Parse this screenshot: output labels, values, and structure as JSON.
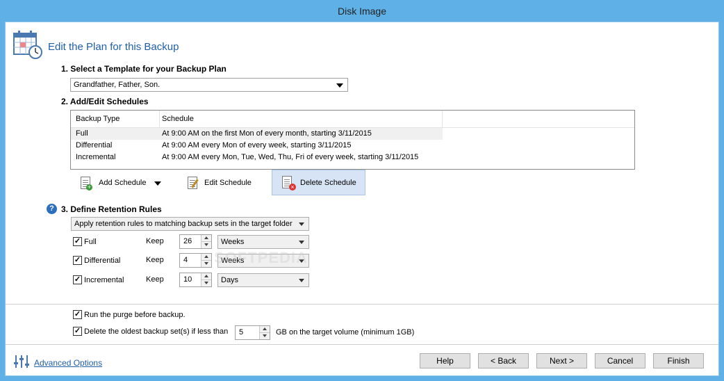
{
  "window": {
    "title": "Disk Image"
  },
  "header": {
    "title": "Edit the Plan for this Backup"
  },
  "template": {
    "heading": "1. Select a Template for your Backup Plan",
    "selected": "Grandfather, Father, Son."
  },
  "schedules": {
    "heading": "2. Add/Edit Schedules",
    "columns": [
      "Backup Type",
      "Schedule"
    ],
    "rows": [
      {
        "type": "Full",
        "schedule": "At 9:00 AM on the first Mon of every month, starting 3/11/2015"
      },
      {
        "type": "Differential",
        "schedule": "At 9:00 AM every Mon of every week, starting 3/11/2015"
      },
      {
        "type": "Incremental",
        "schedule": "At 9:00 AM every Mon, Tue, Wed, Thu, Fri of every week, starting 3/11/2015"
      }
    ],
    "add_label": "Add Schedule",
    "edit_label": "Edit Schedule",
    "delete_label": "Delete Schedule"
  },
  "retention": {
    "heading": "3. Define Retention Rules",
    "mode": "Apply retention rules to matching backup sets in the target folder",
    "keep_label": "Keep",
    "rules": [
      {
        "label": "Full",
        "checked": true,
        "value": "26",
        "unit": "Weeks"
      },
      {
        "label": "Differential",
        "checked": true,
        "value": "4",
        "unit": "Weeks"
      },
      {
        "label": "Incremental",
        "checked": true,
        "value": "10",
        "unit": "Days"
      }
    ]
  },
  "options": {
    "purge_label": "Run the purge before backup.",
    "delete_oldest_label": "Delete the oldest backup set(s) if less than",
    "delete_oldest_value": "5",
    "delete_oldest_suffix": "GB on the target volume (minimum 1GB)"
  },
  "footer": {
    "advanced_label": "Advanced Options",
    "help": "Help",
    "back": "< Back",
    "next": "Next >",
    "cancel": "Cancel",
    "finish": "Finish"
  },
  "watermark": "SOFTPEDIA",
  "colors": {
    "titlebar": "#5fb0e6",
    "accent": "#1f5fa8",
    "selection": "#d7e4f5"
  }
}
